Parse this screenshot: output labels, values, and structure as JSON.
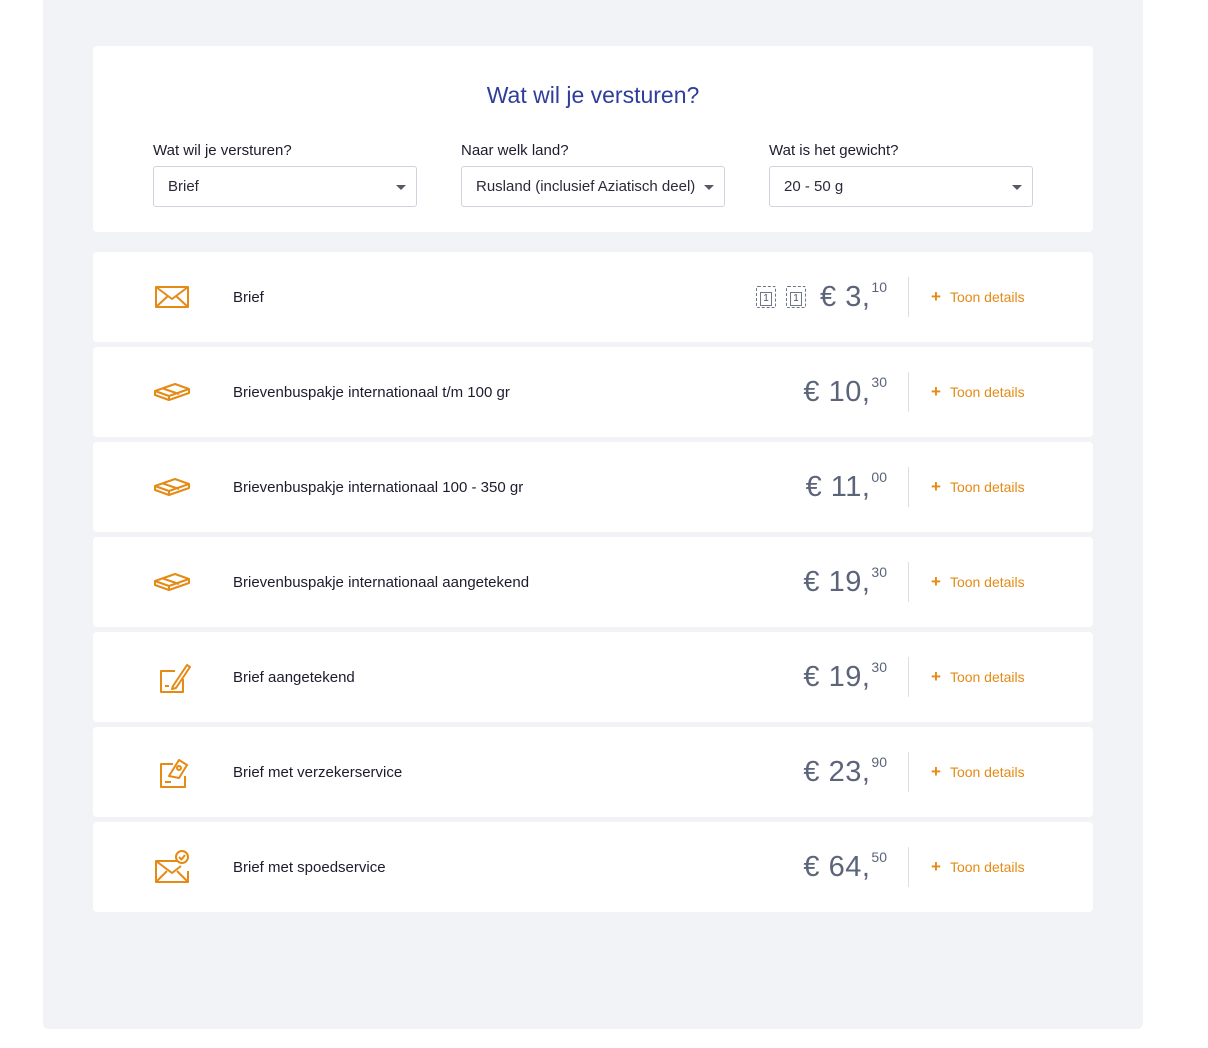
{
  "selector": {
    "title": "Wat wil je versturen?",
    "fields": [
      {
        "label": "Wat wil je versturen?",
        "value": "Brief"
      },
      {
        "label": "Naar welk land?",
        "value": "Rusland (inclusief Aziatisch deel)"
      },
      {
        "label": "Wat is het gewicht?",
        "value": "20 - 50 g"
      }
    ]
  },
  "results": [
    {
      "name": "Brief",
      "icon": "envelope-icon",
      "price_main": "€ 3,",
      "price_dec": "10",
      "stamps": [
        "1",
        "1"
      ],
      "details_label": "Toon details"
    },
    {
      "name": "Brievenbuspakje internationaal t/m 100 gr",
      "icon": "package-icon",
      "price_main": "€ 10,",
      "price_dec": "30",
      "details_label": "Toon details"
    },
    {
      "name": "Brievenbuspakje internationaal 100 - 350 gr",
      "icon": "package-icon",
      "price_main": "€ 11,",
      "price_dec": "00",
      "details_label": "Toon details"
    },
    {
      "name": "Brievenbuspakje internationaal aangetekend",
      "icon": "package-icon",
      "price_main": "€ 19,",
      "price_dec": "30",
      "details_label": "Toon details"
    },
    {
      "name": "Brief aangetekend",
      "icon": "signed-letter-icon",
      "price_main": "€ 19,",
      "price_dec": "30",
      "details_label": "Toon details"
    },
    {
      "name": "Brief met verzekerservice",
      "icon": "insured-letter-icon",
      "price_main": "€ 23,",
      "price_dec": "90",
      "details_label": "Toon details"
    },
    {
      "name": "Brief met spoedservice",
      "icon": "express-letter-icon",
      "price_main": "€ 64,",
      "price_dec": "50",
      "details_label": "Toon details"
    }
  ],
  "colors": {
    "accent": "#e58a14",
    "title": "#2f3d9b",
    "price": "#5b6478",
    "background": "#f2f3f7"
  }
}
